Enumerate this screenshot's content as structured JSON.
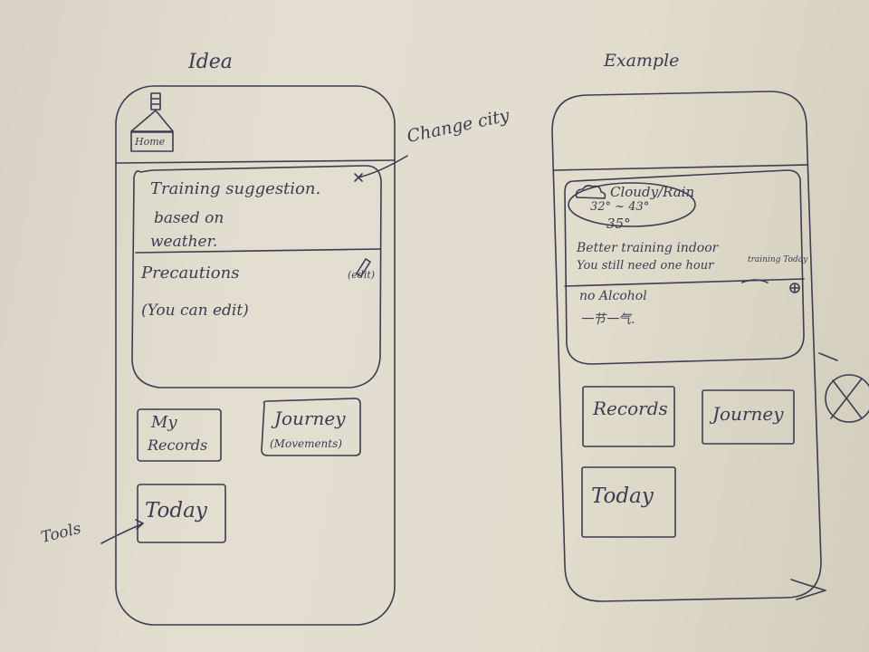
{
  "sketch": {
    "left_title": "Idea",
    "right_title": "Example",
    "ink_color": "#3b3d52",
    "paper_color": "#e2dccd"
  },
  "idea": {
    "home_label": "Home",
    "change_city": "Change city",
    "suggestion_line1": "Training suggestion.",
    "suggestion_line2": "based on",
    "suggestion_line3": "weather.",
    "precautions": "Precautions",
    "edit_label": "(edit)",
    "you_can_edit": "(You can edit)",
    "records_line1": "My",
    "records_line2": "Records",
    "journey_line1": "Journey",
    "journey_line2": "(Movements)",
    "today": "Today",
    "tools": "Tools"
  },
  "example": {
    "weather": "Cloudy/Rain",
    "temp_range": "32° ~ 43°",
    "temp_now": "35°",
    "advice_line1": "Better training indoor",
    "advice_line2": "You still need one hour",
    "advice_line2_end": "training Today",
    "precaution_line1": "no Alcohol",
    "precaution_line2": "一节一气.",
    "records": "Records",
    "journey": "Journey",
    "today": "Today"
  }
}
